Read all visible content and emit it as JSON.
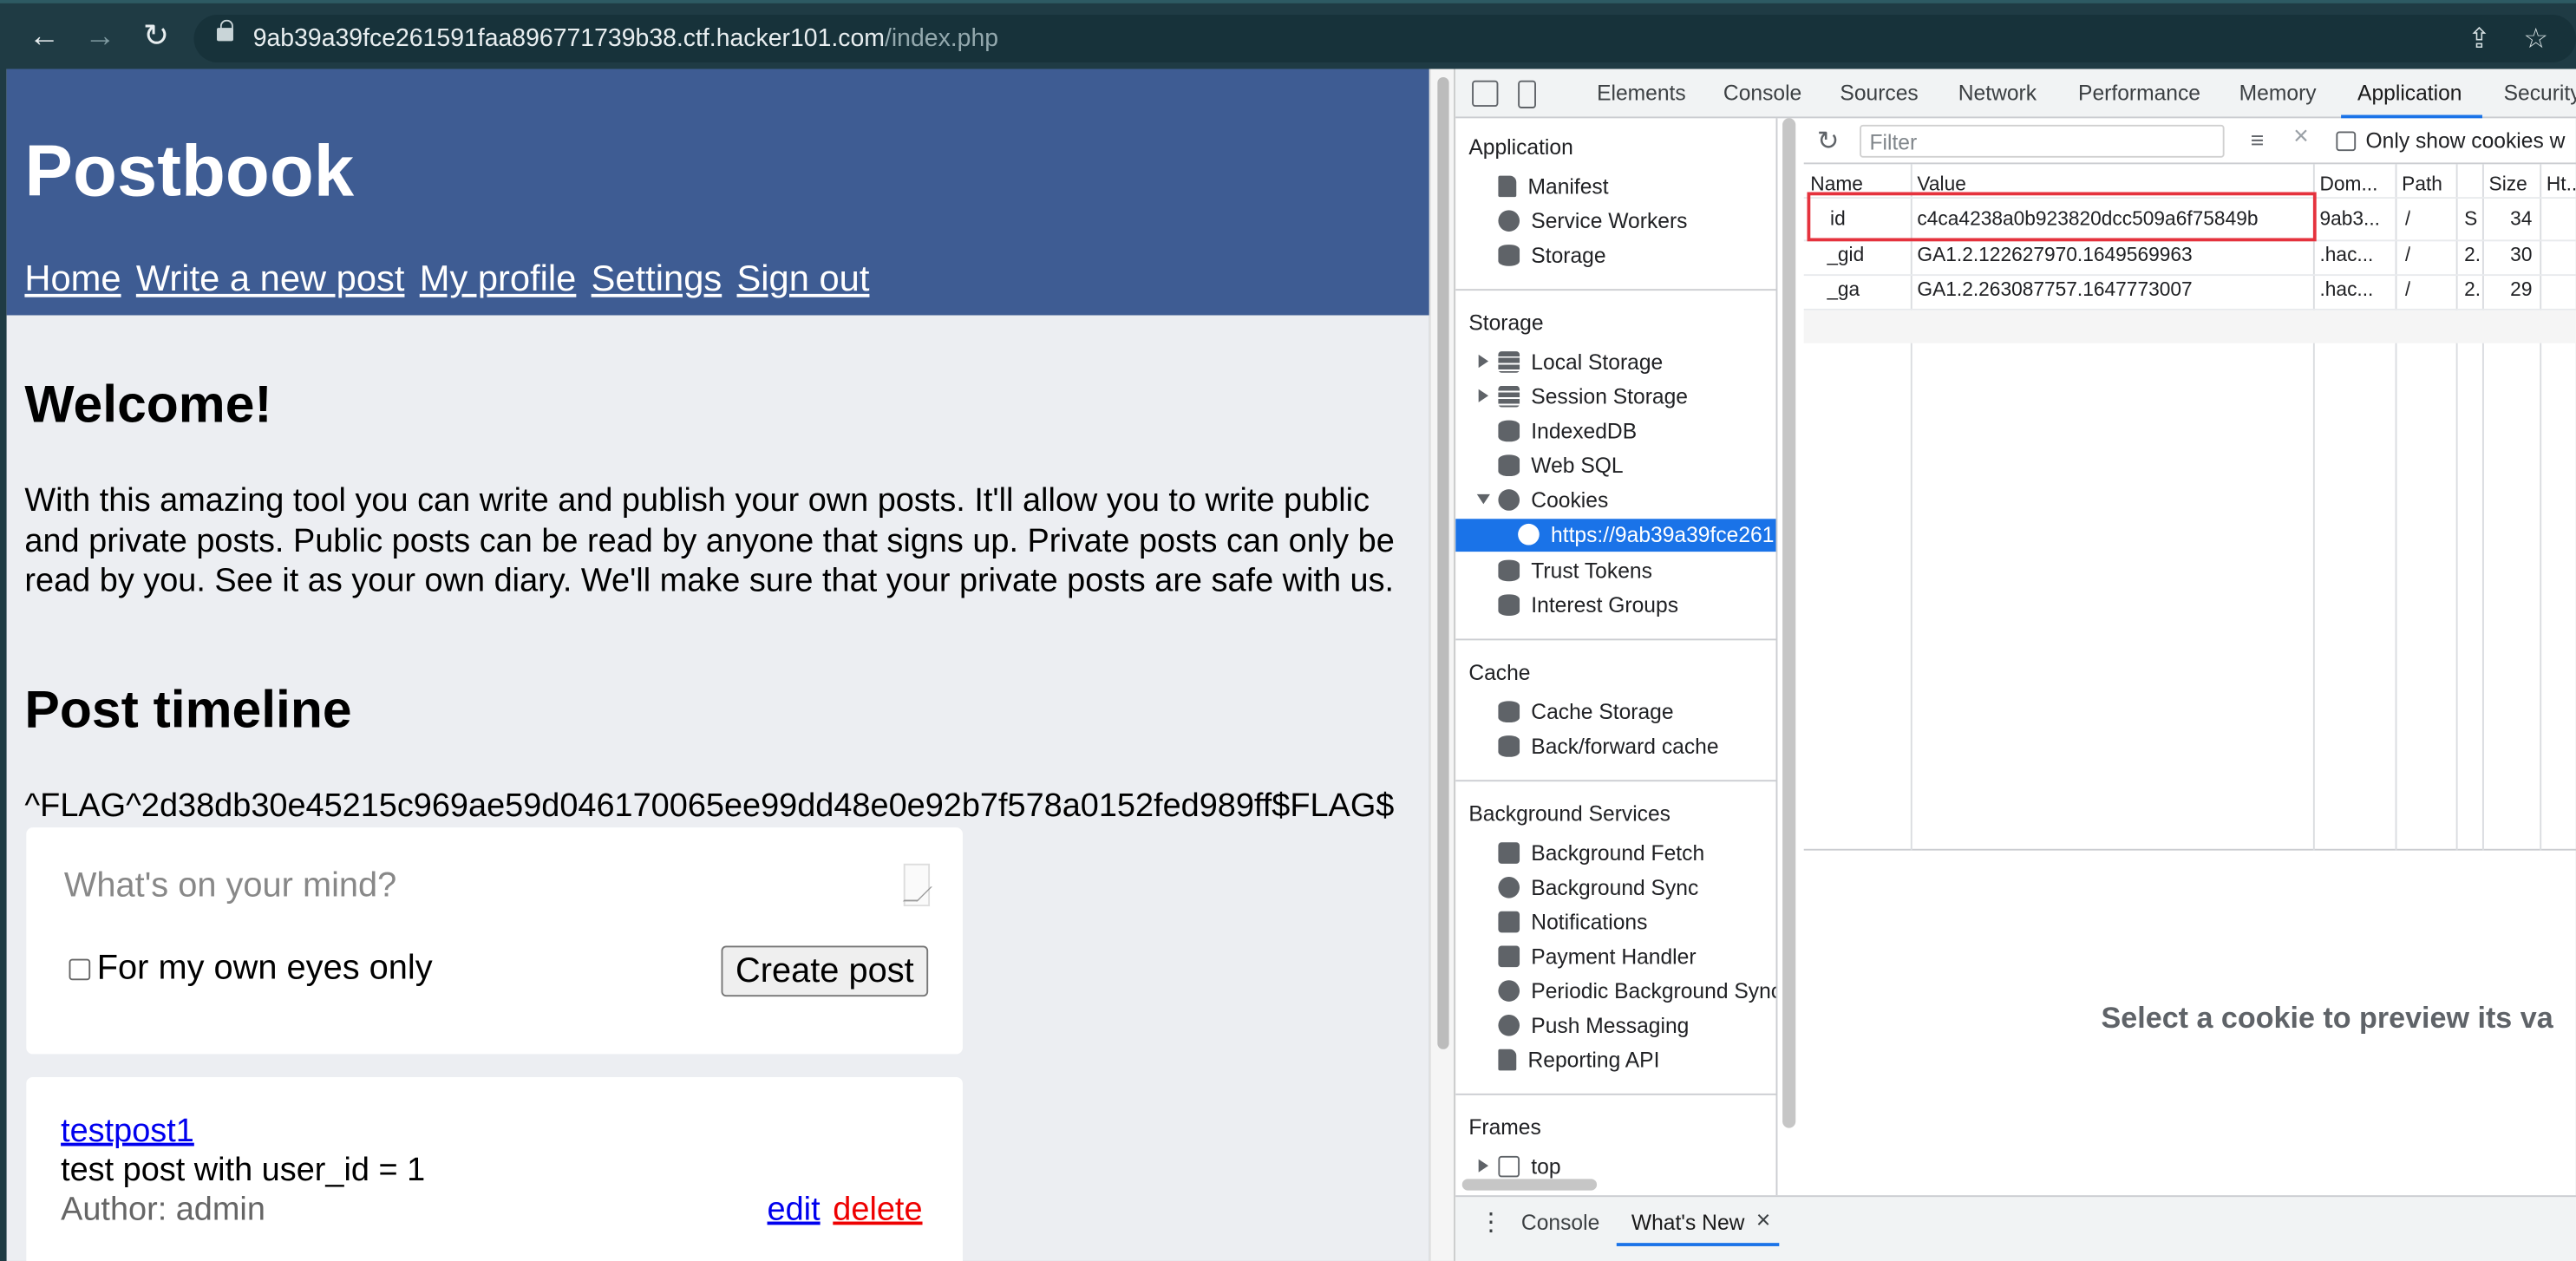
{
  "browser": {
    "back": "←",
    "forward": "→",
    "reload": "↻",
    "url_host": "9ab39a39fce261591faa896771739b38.ctf.hacker101.com",
    "url_path": "/index.php",
    "share": "⇪",
    "star": "☆"
  },
  "page": {
    "logo": "Postbook",
    "nav": [
      "Home",
      "Write a new post",
      "My profile",
      "Settings",
      "Sign out"
    ],
    "welcome": "Welcome!",
    "intro": "With this amazing tool you can write and publish your own posts. It'll allow you to write public and private posts. Public posts can be read by anyone that signs up. Private posts can only be read by you. See it as your own diary. We'll make sure that your private posts are safe with us.",
    "timeline_heading": "Post timeline",
    "flag": "^FLAG^2d38db30e45215c969ae59d046170065ee99dd48e0e92b7f578a0152fed989ff$FLAG$",
    "composer": {
      "placeholder": "What's on your mind?",
      "private_label": "For my own eyes only",
      "create_button": "Create post"
    },
    "post": {
      "title": "testpost1",
      "body": "test post with user_id = 1",
      "author": "Author: admin",
      "edit": "edit",
      "delete": "delete"
    }
  },
  "devtools": {
    "tabs": [
      "Elements",
      "Console",
      "Sources",
      "Network",
      "Performance",
      "Memory",
      "Application",
      "Security"
    ],
    "active_tab": "Application",
    "sidebar": {
      "application_heading": "Application",
      "application_items": [
        "Manifest",
        "Service Workers",
        "Storage"
      ],
      "storage_heading": "Storage",
      "storage_items": [
        "Local Storage",
        "Session Storage",
        "IndexedDB",
        "Web SQL",
        "Cookies"
      ],
      "cookie_origin": "https://9ab39a39fce261",
      "storage_items_after": [
        "Trust Tokens",
        "Interest Groups"
      ],
      "cache_heading": "Cache",
      "cache_items": [
        "Cache Storage",
        "Back/forward cache"
      ],
      "bg_heading": "Background Services",
      "bg_items": [
        "Background Fetch",
        "Background Sync",
        "Notifications",
        "Payment Handler",
        "Periodic Background Sync",
        "Push Messaging",
        "Reporting API"
      ],
      "frames_heading": "Frames",
      "frames_item": "top"
    },
    "cookies": {
      "filter_placeholder": "Filter",
      "only_show_label": "Only show cookies w",
      "headers": [
        "Name",
        "Value",
        "Dom...",
        "Path",
        "",
        "Size",
        "Ht..."
      ],
      "rows": [
        [
          "id",
          "c4ca4238a0b923820dcc509a6f75849b",
          "9ab3...",
          "/",
          "S",
          "34",
          ""
        ],
        [
          "_gid",
          "GA1.2.122627970.1649569963",
          ".hac...",
          "/",
          "2.",
          "30",
          ""
        ],
        [
          "_ga",
          "GA1.2.263087757.1647773007",
          ".hac...",
          "/",
          "2.",
          "29",
          ""
        ]
      ],
      "preview_text": "Select a cookie to preview its va"
    },
    "drawer": {
      "menu": "⋮",
      "tabs": [
        "Console",
        "What's New"
      ],
      "close": "×"
    }
  }
}
